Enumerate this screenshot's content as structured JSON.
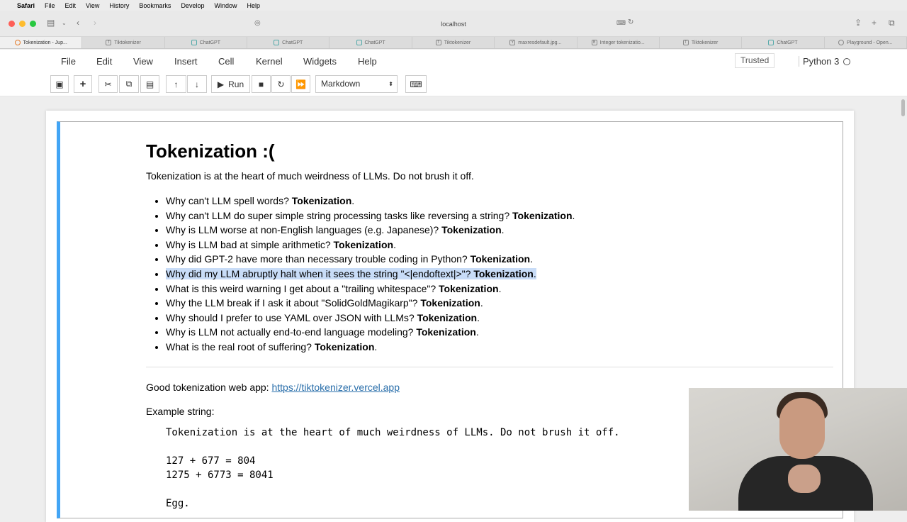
{
  "os_menu": {
    "apple": "",
    "app": "Safari",
    "items": [
      "File",
      "Edit",
      "View",
      "History",
      "Bookmarks",
      "Develop",
      "Window",
      "Help"
    ]
  },
  "browser": {
    "address": "localhost"
  },
  "tabs": [
    {
      "label": "Tokenization - Jup...",
      "active": true
    },
    {
      "label": "Tiktokenizer",
      "active": false
    },
    {
      "label": "ChatGPT",
      "active": false
    },
    {
      "label": "ChatGPT",
      "active": false
    },
    {
      "label": "ChatGPT",
      "active": false
    },
    {
      "label": "Tiktokenizer",
      "active": false
    },
    {
      "label": "maxresdefault.jpg...",
      "active": false
    },
    {
      "label": "Integer tokenizatio...",
      "active": false
    },
    {
      "label": "Tiktokenizer",
      "active": false
    },
    {
      "label": "ChatGPT",
      "active": false
    },
    {
      "label": "Playground - Open...",
      "active": false
    }
  ],
  "jupyter": {
    "menu": [
      "File",
      "Edit",
      "View",
      "Insert",
      "Cell",
      "Kernel",
      "Widgets",
      "Help"
    ],
    "trusted": "Trusted",
    "kernel": "Python 3",
    "run_label": "Run",
    "cell_type": "Markdown"
  },
  "notebook": {
    "title": "Tokenization :(",
    "intro": "Tokenization is at the heart of much weirdness of LLMs. Do not brush it off.",
    "bullets": [
      {
        "q": "Why can't LLM spell words? ",
        "a": "Tokenization",
        "end": "."
      },
      {
        "q": "Why can't LLM do super simple string processing tasks like reversing a string? ",
        "a": "Tokenization",
        "end": "."
      },
      {
        "q": "Why is LLM worse at non-English languages (e.g. Japanese)? ",
        "a": "Tokenization",
        "end": "."
      },
      {
        "q": "Why is LLM bad at simple arithmetic? ",
        "a": "Tokenization",
        "end": "."
      },
      {
        "q": "Why did GPT-2 have more than necessary trouble coding in Python? ",
        "a": "Tokenization",
        "end": "."
      },
      {
        "q": "Why did my LLM abruptly halt when it sees the string \"<|endoftext|>\"? ",
        "a": "Tokenization",
        "end": "."
      },
      {
        "q": "What is this weird warning I get about a \"trailing whitespace\"? ",
        "a": "Tokenization",
        "end": "."
      },
      {
        "q": "Why the LLM break if I ask it about \"SolidGoldMagikarp\"? ",
        "a": "Tokenization",
        "end": "."
      },
      {
        "q": "Why should I prefer to use YAML over JSON with LLMs? ",
        "a": "Tokenization",
        "end": "."
      },
      {
        "q": "Why is LLM not actually end-to-end language modeling? ",
        "a": "Tokenization",
        "end": "."
      },
      {
        "q": "What is the real root of suffering? ",
        "a": "Tokenization",
        "end": "."
      }
    ],
    "webapp_label": "Good tokenization web app: ",
    "webapp_link": "https://tiktokenizer.vercel.app",
    "example_label": "Example string:",
    "code": "Tokenization is at the heart of much weirdness of LLMs. Do not brush it off.\n\n127 + 677 = 804\n1275 + 6773 = 8041\n\nEgg."
  }
}
